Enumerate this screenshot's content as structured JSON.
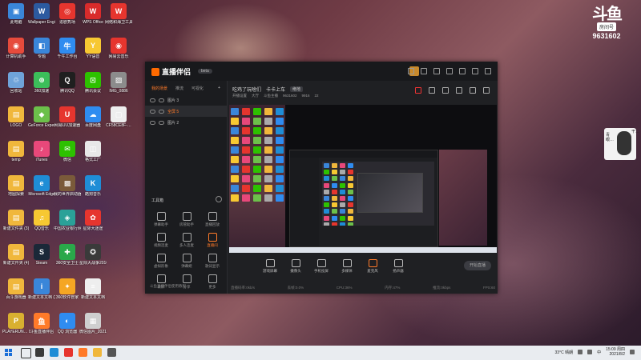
{
  "desktop": {
    "columns": [
      [
        {
          "label": "此电脑",
          "color": "#3a86d9",
          "glyph": "▣"
        },
        {
          "label": "计算机助手",
          "color": "#e64b3c",
          "glyph": "◉"
        },
        {
          "label": "回收站",
          "color": "#6fa3d9",
          "glyph": "♲"
        },
        {
          "label": "LOGO",
          "color": "#f0b73c",
          "glyph": "▤"
        },
        {
          "label": "temp",
          "color": "#f0b73c",
          "glyph": "▤"
        },
        {
          "label": "地图探索",
          "color": "#f0b73c",
          "glyph": "▤"
        },
        {
          "label": "新建文件夹 (3)",
          "color": "#f0b73c",
          "glyph": "▤"
        },
        {
          "label": "新建文件夹 (4)",
          "color": "#f0b73c",
          "glyph": "▤"
        },
        {
          "label": "百斗游戏器",
          "color": "#f0b73c",
          "glyph": "▤"
        },
        {
          "label": "PLAYERUN… BATTLEGR…",
          "color": "#d9b030",
          "glyph": "P"
        }
      ],
      [
        {
          "label": "Wallpaper Engine:…",
          "color": "#2c5aa0",
          "glyph": "W"
        },
        {
          "label": "专题",
          "color": "#3a86d9",
          "glyph": "◧"
        },
        {
          "label": "360加速",
          "color": "#3cbf5a",
          "glyph": "⊕"
        },
        {
          "label": "GeForce Experience",
          "color": "#6cc04a",
          "glyph": "◆"
        },
        {
          "label": "iTunes",
          "color": "#e8487a",
          "glyph": "♪"
        },
        {
          "label": "Microsoft Edge",
          "color": "#1f8dd6",
          "glyph": "e"
        },
        {
          "label": "QQ音乐",
          "color": "#f7c832",
          "glyph": "♫"
        },
        {
          "label": "Steam",
          "color": "#1b2838",
          "glyph": "S"
        },
        {
          "label": "新建文本文档 (2)",
          "color": "#3a86d9",
          "glyph": "i"
        },
        {
          "label": "斗鱼直播伴侣",
          "color": "#ff7a29",
          "glyph": "鱼"
        }
      ],
      [
        {
          "label": "追剧秀场",
          "color": "#e6352e",
          "glyph": "◎"
        },
        {
          "label": "千牛工作台",
          "color": "#2f8cf0",
          "glyph": "牛"
        },
        {
          "label": "腾讯QQ",
          "color": "#1f1f1f",
          "glyph": "Q"
        },
        {
          "label": "网易UU加速器",
          "color": "#e6352e",
          "glyph": "U"
        },
        {
          "label": "微信",
          "color": "#2dc100",
          "glyph": "✉"
        },
        {
          "label": "我的世界启动器",
          "color": "#7a5a3a",
          "glyph": "▩"
        },
        {
          "label": "中国农业银行网银助手",
          "color": "#2aa198",
          "glyph": "◈"
        },
        {
          "label": "360安全卫士",
          "color": "#2aa84a",
          "glyph": "✚"
        },
        {
          "label": "360软件管家",
          "color": "#f5a623",
          "glyph": "✦"
        },
        {
          "label": "QQ 浏览器",
          "color": "#2f8cf0",
          "glyph": "◐"
        }
      ],
      [
        {
          "label": "WPS Office",
          "color": "#d92b2b",
          "glyph": "W"
        },
        {
          "label": "YY语音",
          "color": "#f7c832",
          "glyph": "Y"
        },
        {
          "label": "腾讯会议",
          "color": "#2dc100",
          "glyph": "⊡"
        },
        {
          "label": "百度网盘",
          "color": "#2f8cf0",
          "glyph": "☁"
        },
        {
          "label": "格式工厂",
          "color": "#e8e8e8",
          "glyph": "◫"
        },
        {
          "label": "酷狗音乐",
          "color": "#1f8dd6",
          "glyph": "K"
        },
        {
          "label": "星际大迷途",
          "color": "#e6352e",
          "glyph": "✿"
        },
        {
          "label": "星际大战争2010年度版",
          "color": "#3a3a3a",
          "glyph": "✪"
        },
        {
          "label": "新建文本文档",
          "color": "#eeeeee",
          "glyph": "≡"
        },
        {
          "label": "微信图片_2021082…",
          "color": "#cfcfcf",
          "glyph": "▦"
        }
      ],
      [
        {
          "label": "网络和海卫工具体验版",
          "color": "#e6352e",
          "glyph": "W"
        },
        {
          "label": "网易云音乐",
          "color": "#e6352e",
          "glyph": "◉"
        },
        {
          "label": "IMG_0886",
          "color": "#8c8c8c",
          "glyph": "▨"
        },
        {
          "label": "CF58CE8F-…",
          "color": "#eeeeee",
          "glyph": "▢"
        }
      ]
    ]
  },
  "watermark": {
    "logo": "斗鱼",
    "tag": "房间号",
    "room_id": "9631602"
  },
  "avatar_text": [
    "青眼…",
    "干…",
    "可…"
  ],
  "app": {
    "title": "直播伴侣",
    "version": "beta",
    "side_tabs": [
      "我的场景",
      "推流",
      "可视化"
    ],
    "scenes": [
      {
        "label": "图片 3",
        "active": false
      },
      {
        "label": "全屏 5",
        "active": true
      },
      {
        "label": "图片 2",
        "active": false
      }
    ],
    "tools_title": "工具箱",
    "tools": [
      {
        "label": "弹幕助手",
        "highlight": false
      },
      {
        "label": "房管助手",
        "highlight": false
      },
      {
        "label": "直播回放",
        "highlight": false
      },
      {
        "label": "视频连麦",
        "highlight": false
      },
      {
        "label": "多人连麦",
        "highlight": false
      },
      {
        "label": "直播间",
        "highlight": true
      },
      {
        "label": "虚拟形象",
        "highlight": false
      },
      {
        "label": "弹幕姬",
        "highlight": false
      },
      {
        "label": "歌词显示",
        "highlight": false
      },
      {
        "label": "录屏",
        "highlight": false
      },
      {
        "label": "分享",
        "highlight": false
      },
      {
        "label": "更多",
        "highlight": false
      }
    ],
    "side_footer": "斗鱼直播伴侣使用教程",
    "info_title": "吃鸡了玩啥们",
    "info_sub": "卡卡上车",
    "info_badge": "绝地",
    "info_items": [
      "开播设置",
      "大厅",
      "斗鱼主播",
      "9631602",
      "9916",
      "22"
    ],
    "controls": [
      {
        "label": "游戏屏幕",
        "mic": false
      },
      {
        "label": "摄像头",
        "mic": false
      },
      {
        "label": "手机投屏",
        "mic": false
      },
      {
        "label": "多媒体",
        "mic": false
      },
      {
        "label": "麦克风",
        "mic": true
      },
      {
        "label": "扬声器",
        "mic": false
      }
    ],
    "live_button": "开始直播",
    "stats": [
      "直播码率:0kb/s",
      "丢帧:0.0%",
      "CPU:36%",
      "内存:47%",
      "推流:0kbps",
      "FPS:60"
    ]
  },
  "taskbar": {
    "weather": "33°C 晴朗",
    "time": "15:09 周四",
    "date": "2021/8/2",
    "lang": "中"
  }
}
